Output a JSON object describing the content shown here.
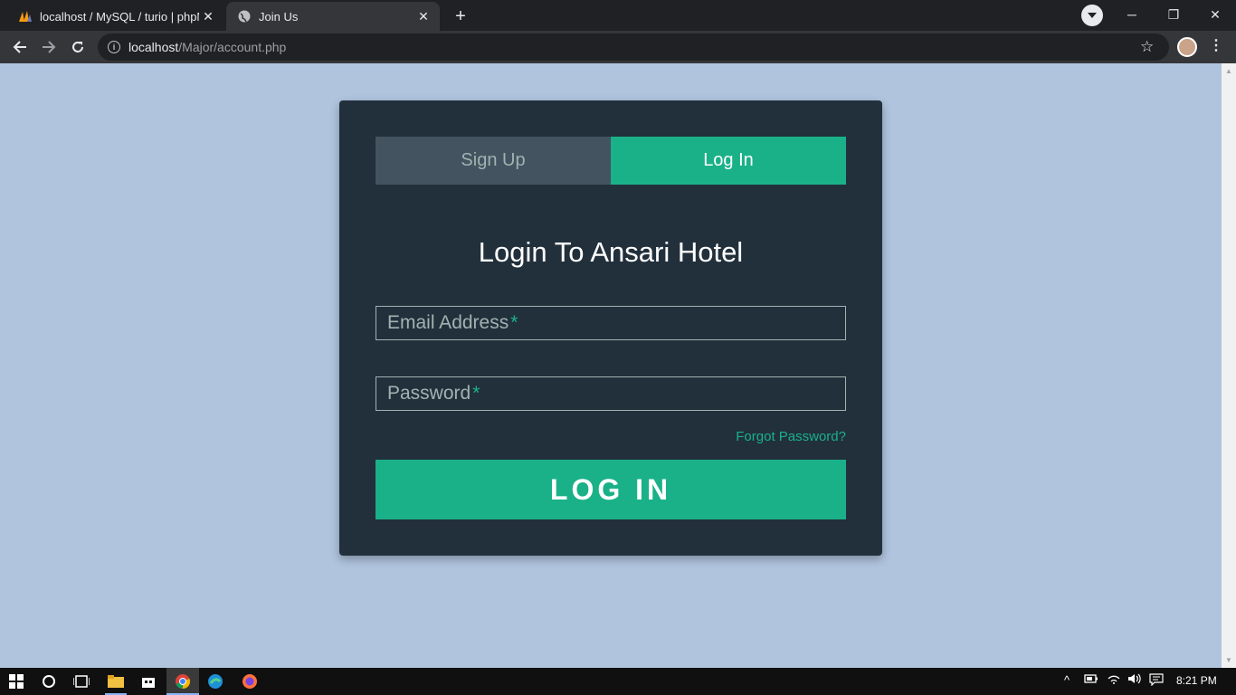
{
  "browser": {
    "tabs": [
      {
        "title": "localhost / MySQL / turio | phpM",
        "active": false
      },
      {
        "title": "Join Us",
        "active": true
      }
    ],
    "url_host": "localhost",
    "url_path": "/Major/account.php",
    "new_tab_label": "+"
  },
  "page": {
    "tabs": {
      "signup_label": "Sign Up",
      "login_label": "Log In"
    },
    "heading": "Login To Ansari Hotel",
    "email_placeholder": "Email Address",
    "password_placeholder": "Password",
    "required_mark": "*",
    "forgot_password": "Forgot Password?",
    "submit_label": "LOG IN"
  },
  "taskbar": {
    "time": "8:21 PM"
  },
  "colors": {
    "background": "#b0c4de",
    "card": "#22303c",
    "accent": "#1ab188",
    "inactive_tab": "#435360",
    "muted_text": "#a0b3b0"
  },
  "icons": [
    "phpmyadmin-icon",
    "globe-icon",
    "close-icon",
    "plus-icon",
    "tab-search-icon",
    "minimize-icon",
    "restore-icon",
    "window-close-icon",
    "back-icon",
    "forward-icon",
    "reload-icon",
    "info-icon",
    "star-icon",
    "avatar",
    "menu-icon",
    "windows-start-icon",
    "cortana-icon",
    "task-view-icon",
    "file-explorer-icon",
    "store-icon",
    "chrome-icon",
    "edge-icon",
    "firefox-icon",
    "chevron-up-icon",
    "battery-icon",
    "wifi-icon",
    "volume-icon",
    "notification-icon"
  ]
}
